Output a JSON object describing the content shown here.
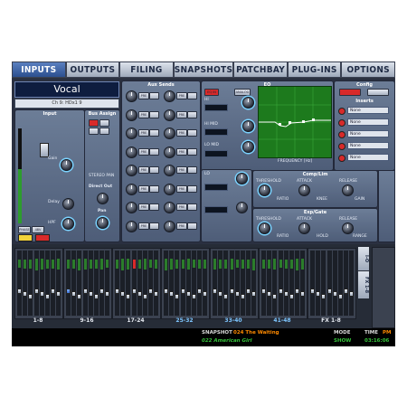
{
  "tabs": [
    "INPUTS",
    "OUTPUTS",
    "FILING",
    "SNAPSHOTS",
    "PATCHBAY",
    "PLUG-INS",
    "OPTIONS"
  ],
  "channel": {
    "name": "Vocal",
    "source": "Ch 9: HDx1 9"
  },
  "input": {
    "title": "Input",
    "gain_label": "Gain",
    "delay_label": "Delay",
    "hpf_label": "HPF",
    "phase_label": "PHASE",
    "pad_label": "48V"
  },
  "bus_assign": {
    "title": "Bus Assign",
    "direct_out": "Direct Out",
    "pan": "Pan",
    "stereo": "STEREO PAN"
  },
  "aux_sends": {
    "title": "Aux Sends",
    "pre_label": "PRE",
    "rows": 8
  },
  "eq": {
    "title": "EQ",
    "freq_label": "FREQUENCY [Hz]",
    "gain_axis": "GAIN [dB]",
    "in": "EQ IN",
    "analog": "ANALOG",
    "bands": [
      "HI",
      "HI MID",
      "LO MID",
      "LO"
    ]
  },
  "config": {
    "title": "Config",
    "inserts": "Inserts",
    "items": [
      "None",
      "None",
      "None",
      "None",
      "None"
    ]
  },
  "comp": {
    "title": "Comp/Lim",
    "threshold": "THRESHOLD",
    "attack": "ATTACK",
    "release": "RELEASE",
    "ratio": "RATIO",
    "knee": "KNEE",
    "gain": "GAIN"
  },
  "gate": {
    "title": "Exp/Gate",
    "threshold": "THRESHOLD",
    "attack": "ATTACK",
    "release": "RELEASE",
    "ratio": "RATIO",
    "hold": "HOLD",
    "range": "RANGE"
  },
  "banks": [
    "1-8",
    "9-16",
    "17-24",
    "25-32",
    "33-40",
    "41-48",
    "FX 1-8"
  ],
  "bank_blue": [
    false,
    false,
    false,
    true,
    true,
    true,
    false
  ],
  "right_tabs": [
    "I-O",
    "FX 1-8"
  ],
  "status": {
    "snapshot_label": "SNAPSHOT",
    "snapshot_current": "024 The Waiting",
    "snapshot_next": "022 American Girl",
    "mode_label": "MODE",
    "mode_value": "SHOW",
    "time_label": "TIME",
    "time_ampm": "PM",
    "time_value": "03:16:06"
  },
  "colors": {
    "accent": "#2c4f8f",
    "status_orange": "#ff8a00",
    "status_green": "#35c23a"
  }
}
